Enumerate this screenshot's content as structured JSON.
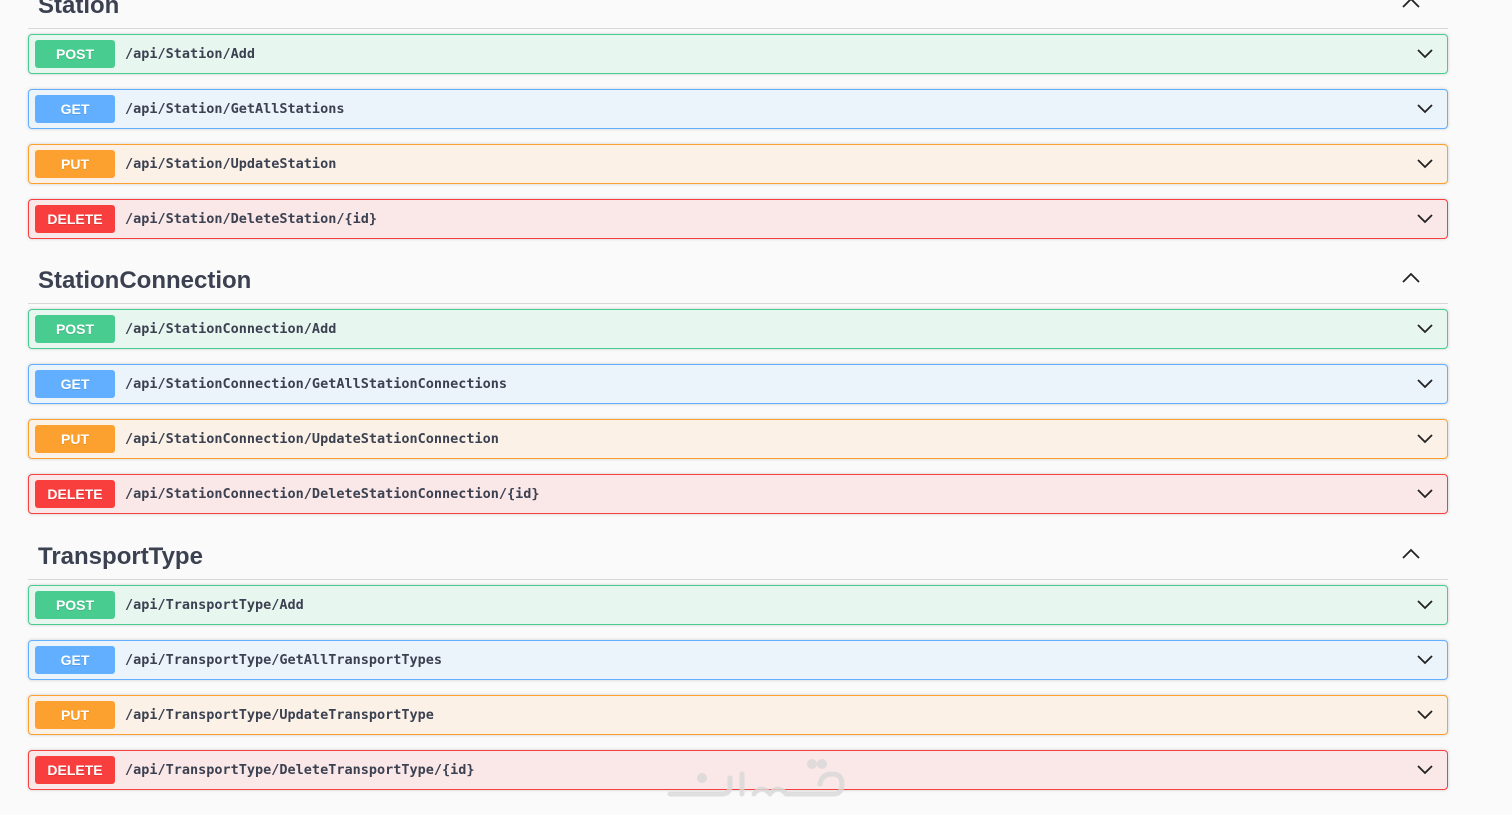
{
  "sections": [
    {
      "title": "Station",
      "toggle_icon": "chevron-up-icon",
      "operations": [
        {
          "method": "POST",
          "path": "/api/Station/Add"
        },
        {
          "method": "GET",
          "path": "/api/Station/GetAllStations"
        },
        {
          "method": "PUT",
          "path": "/api/Station/UpdateStation"
        },
        {
          "method": "DELETE",
          "path": "/api/Station/DeleteStation/{id}"
        }
      ]
    },
    {
      "title": "StationConnection",
      "toggle_icon": "chevron-up-icon",
      "operations": [
        {
          "method": "POST",
          "path": "/api/StationConnection/Add"
        },
        {
          "method": "GET",
          "path": "/api/StationConnection/GetAllStationConnections"
        },
        {
          "method": "PUT",
          "path": "/api/StationConnection/UpdateStationConnection"
        },
        {
          "method": "DELETE",
          "path": "/api/StationConnection/DeleteStationConnection/{id}"
        }
      ]
    },
    {
      "title": "TransportType",
      "toggle_icon": "chevron-up-icon",
      "operations": [
        {
          "method": "POST",
          "path": "/api/TransportType/Add"
        },
        {
          "method": "GET",
          "path": "/api/TransportType/GetAllTransportTypes"
        },
        {
          "method": "PUT",
          "path": "/api/TransportType/UpdateTransportType"
        },
        {
          "method": "DELETE",
          "path": "/api/TransportType/DeleteTransportType/{id}"
        }
      ]
    }
  ],
  "colors": {
    "post": "#49cc90",
    "get": "#61affe",
    "put": "#fca130",
    "delete": "#f93e3e",
    "text": "#3b4151"
  },
  "watermark": "خدسات"
}
